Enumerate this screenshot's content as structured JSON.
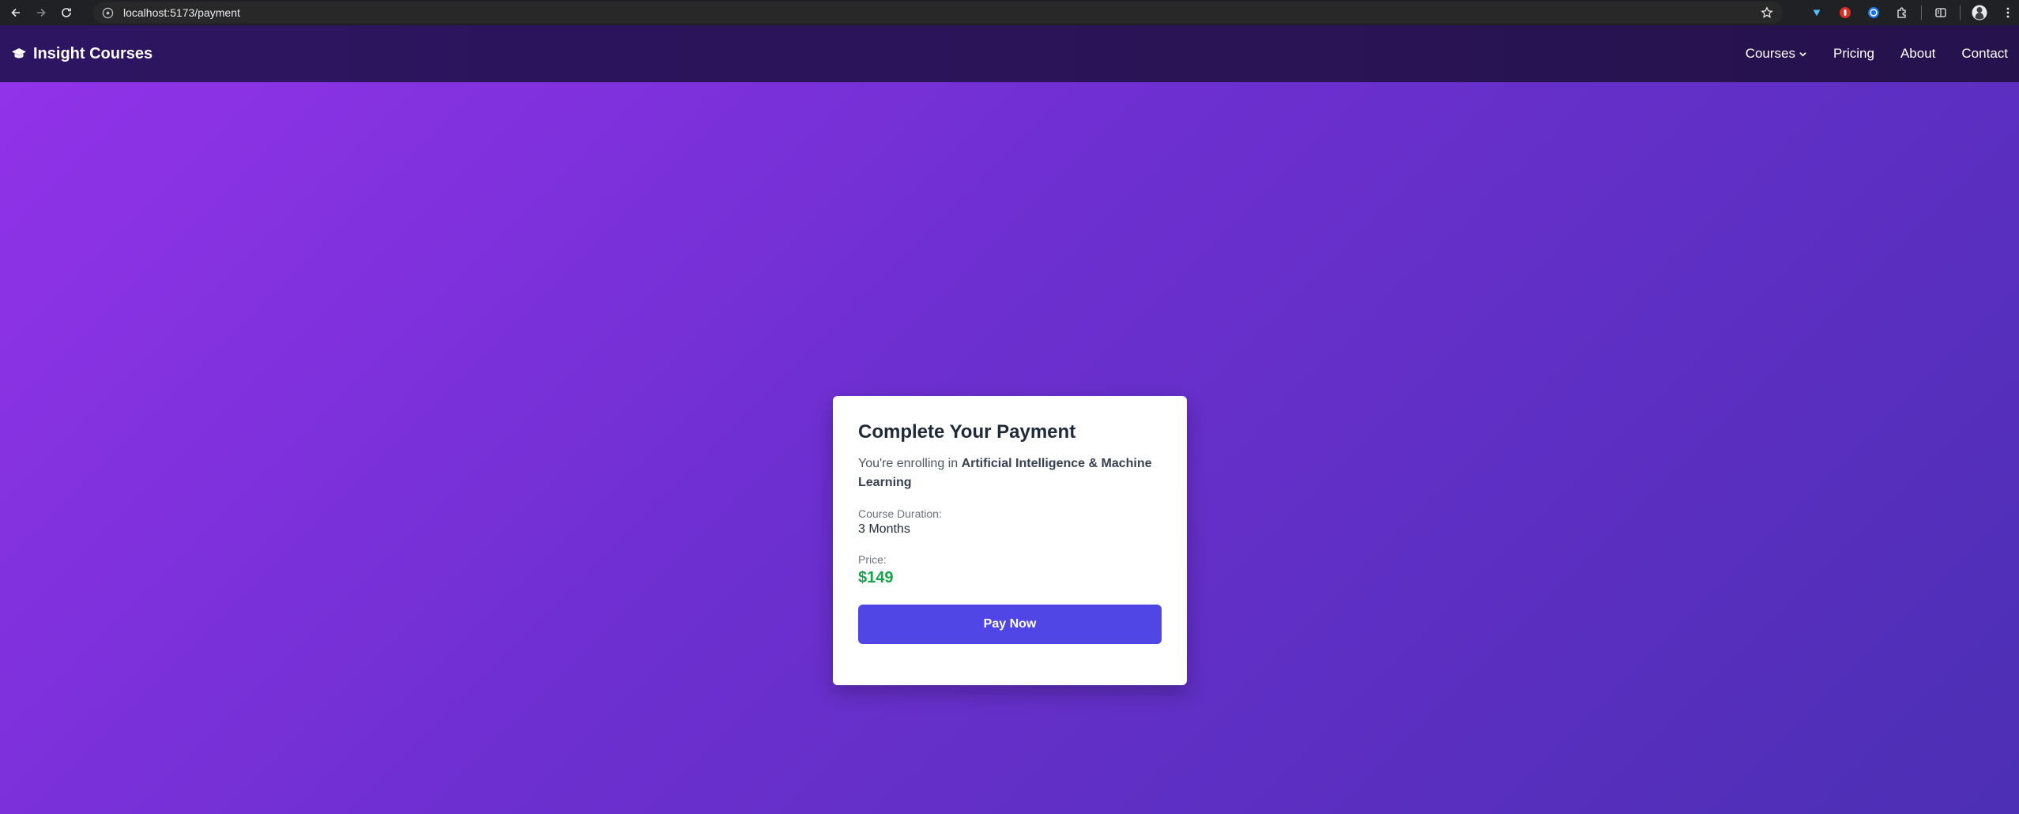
{
  "browser": {
    "url": "localhost:5173/payment"
  },
  "navbar": {
    "brand": "Insight Courses",
    "links": {
      "courses": "Courses",
      "pricing": "Pricing",
      "about": "About",
      "contact": "Contact"
    }
  },
  "payment": {
    "title": "Complete Your Payment",
    "enroll_prefix": "You're enrolling in ",
    "course_name": "Artificial Intelligence & Machine Learning",
    "duration_label": "Course Duration:",
    "duration_value": "3 Months",
    "price_label": "Price:",
    "price_value": "$149",
    "pay_button": "Pay Now"
  },
  "colors": {
    "navbar": "#2b1458",
    "gradient_start": "#9333ea",
    "gradient_end": "#4c2fb4",
    "button": "#4f46e5",
    "price": "#16a34a"
  }
}
